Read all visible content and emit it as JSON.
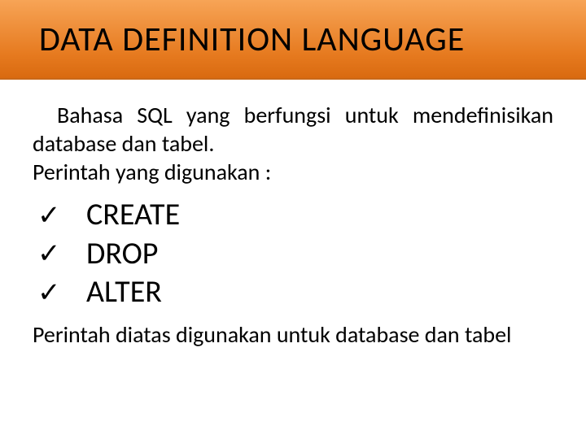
{
  "header": {
    "title": "DATA DEFINITION LANGUAGE"
  },
  "body": {
    "intro_line1": "Bahasa SQL yang berfungsi untuk mendefinisikan database dan tabel.",
    "intro_line2": "Perintah yang digunakan :",
    "list": {
      "check": "✓",
      "items": [
        "CREATE",
        "DROP",
        "ALTER"
      ]
    },
    "closing": "Perintah diatas digunakan untuk database dan tabel"
  }
}
